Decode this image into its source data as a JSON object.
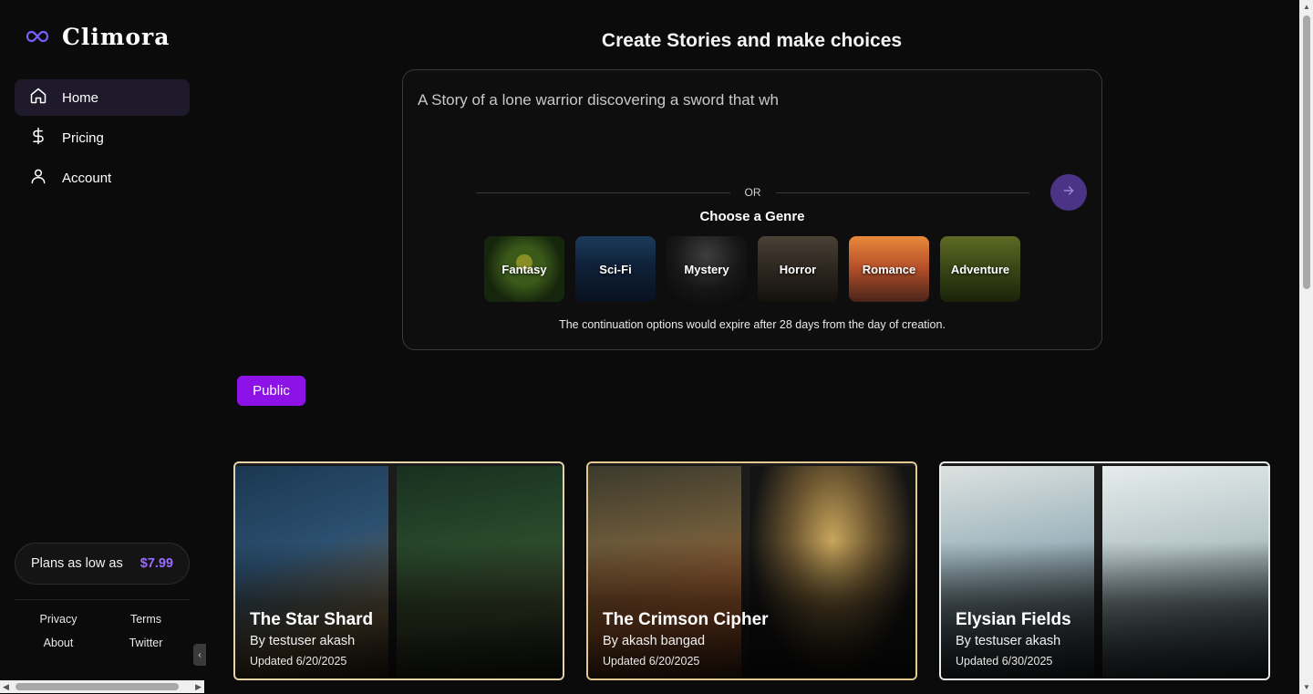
{
  "brand": {
    "name": "Climora",
    "logo_icon": "infinity-icon",
    "accent": "#7b5cff"
  },
  "nav": [
    {
      "label": "Home",
      "icon": "home-icon",
      "active": true
    },
    {
      "label": "Pricing",
      "icon": "dollar-icon",
      "active": false
    },
    {
      "label": "Account",
      "icon": "user-icon",
      "active": false
    }
  ],
  "plans": {
    "text": "Plans as low as",
    "price": "$7.99"
  },
  "footer": {
    "privacy": "Privacy",
    "terms": "Terms",
    "about": "About",
    "twitter": "Twitter"
  },
  "main": {
    "title": "Create Stories and make choices",
    "prompt_value": "A Story of a lone warrior discovering a sword that wh",
    "or_text": "OR",
    "genre_title": "Choose a Genre",
    "genres": [
      "Fantasy",
      "Sci-Fi",
      "Mystery",
      "Horror",
      "Romance",
      "Adventure"
    ],
    "expire_note": "The continuation options would expire after 28 days from the day of creation.",
    "public_label": "Public"
  },
  "stories": [
    {
      "title": "The Star Shard",
      "author": "By testuser akash",
      "updated": "Updated 6/20/2025"
    },
    {
      "title": "The Crimson Cipher",
      "author": "By akash bangad",
      "updated": "Updated 6/20/2025"
    },
    {
      "title": "Elysian Fields",
      "author": "By testuser akash",
      "updated": "Updated 6/30/2025"
    }
  ]
}
